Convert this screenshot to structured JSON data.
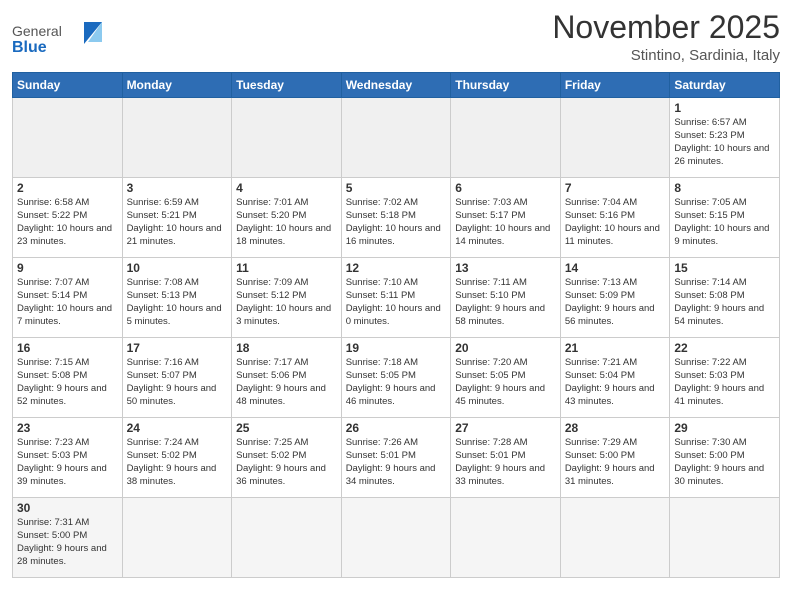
{
  "header": {
    "logo_general": "General",
    "logo_blue": "Blue",
    "month_year": "November 2025",
    "location": "Stintino, Sardinia, Italy"
  },
  "weekdays": [
    "Sunday",
    "Monday",
    "Tuesday",
    "Wednesday",
    "Thursday",
    "Friday",
    "Saturday"
  ],
  "weeks": [
    [
      {
        "day": "",
        "info": "",
        "empty": true
      },
      {
        "day": "",
        "info": "",
        "empty": true
      },
      {
        "day": "",
        "info": "",
        "empty": true
      },
      {
        "day": "",
        "info": "",
        "empty": true
      },
      {
        "day": "",
        "info": "",
        "empty": true
      },
      {
        "day": "",
        "info": "",
        "empty": true
      },
      {
        "day": "1",
        "info": "Sunrise: 6:57 AM\nSunset: 5:23 PM\nDaylight: 10 hours and 26 minutes."
      }
    ],
    [
      {
        "day": "2",
        "info": "Sunrise: 6:58 AM\nSunset: 5:22 PM\nDaylight: 10 hours and 23 minutes."
      },
      {
        "day": "3",
        "info": "Sunrise: 6:59 AM\nSunset: 5:21 PM\nDaylight: 10 hours and 21 minutes."
      },
      {
        "day": "4",
        "info": "Sunrise: 7:01 AM\nSunset: 5:20 PM\nDaylight: 10 hours and 18 minutes."
      },
      {
        "day": "5",
        "info": "Sunrise: 7:02 AM\nSunset: 5:18 PM\nDaylight: 10 hours and 16 minutes."
      },
      {
        "day": "6",
        "info": "Sunrise: 7:03 AM\nSunset: 5:17 PM\nDaylight: 10 hours and 14 minutes."
      },
      {
        "day": "7",
        "info": "Sunrise: 7:04 AM\nSunset: 5:16 PM\nDaylight: 10 hours and 11 minutes."
      },
      {
        "day": "8",
        "info": "Sunrise: 7:05 AM\nSunset: 5:15 PM\nDaylight: 10 hours and 9 minutes."
      }
    ],
    [
      {
        "day": "9",
        "info": "Sunrise: 7:07 AM\nSunset: 5:14 PM\nDaylight: 10 hours and 7 minutes."
      },
      {
        "day": "10",
        "info": "Sunrise: 7:08 AM\nSunset: 5:13 PM\nDaylight: 10 hours and 5 minutes."
      },
      {
        "day": "11",
        "info": "Sunrise: 7:09 AM\nSunset: 5:12 PM\nDaylight: 10 hours and 3 minutes."
      },
      {
        "day": "12",
        "info": "Sunrise: 7:10 AM\nSunset: 5:11 PM\nDaylight: 10 hours and 0 minutes."
      },
      {
        "day": "13",
        "info": "Sunrise: 7:11 AM\nSunset: 5:10 PM\nDaylight: 9 hours and 58 minutes."
      },
      {
        "day": "14",
        "info": "Sunrise: 7:13 AM\nSunset: 5:09 PM\nDaylight: 9 hours and 56 minutes."
      },
      {
        "day": "15",
        "info": "Sunrise: 7:14 AM\nSunset: 5:08 PM\nDaylight: 9 hours and 54 minutes."
      }
    ],
    [
      {
        "day": "16",
        "info": "Sunrise: 7:15 AM\nSunset: 5:08 PM\nDaylight: 9 hours and 52 minutes."
      },
      {
        "day": "17",
        "info": "Sunrise: 7:16 AM\nSunset: 5:07 PM\nDaylight: 9 hours and 50 minutes."
      },
      {
        "day": "18",
        "info": "Sunrise: 7:17 AM\nSunset: 5:06 PM\nDaylight: 9 hours and 48 minutes."
      },
      {
        "day": "19",
        "info": "Sunrise: 7:18 AM\nSunset: 5:05 PM\nDaylight: 9 hours and 46 minutes."
      },
      {
        "day": "20",
        "info": "Sunrise: 7:20 AM\nSunset: 5:05 PM\nDaylight: 9 hours and 45 minutes."
      },
      {
        "day": "21",
        "info": "Sunrise: 7:21 AM\nSunset: 5:04 PM\nDaylight: 9 hours and 43 minutes."
      },
      {
        "day": "22",
        "info": "Sunrise: 7:22 AM\nSunset: 5:03 PM\nDaylight: 9 hours and 41 minutes."
      }
    ],
    [
      {
        "day": "23",
        "info": "Sunrise: 7:23 AM\nSunset: 5:03 PM\nDaylight: 9 hours and 39 minutes."
      },
      {
        "day": "24",
        "info": "Sunrise: 7:24 AM\nSunset: 5:02 PM\nDaylight: 9 hours and 38 minutes."
      },
      {
        "day": "25",
        "info": "Sunrise: 7:25 AM\nSunset: 5:02 PM\nDaylight: 9 hours and 36 minutes."
      },
      {
        "day": "26",
        "info": "Sunrise: 7:26 AM\nSunset: 5:01 PM\nDaylight: 9 hours and 34 minutes."
      },
      {
        "day": "27",
        "info": "Sunrise: 7:28 AM\nSunset: 5:01 PM\nDaylight: 9 hours and 33 minutes."
      },
      {
        "day": "28",
        "info": "Sunrise: 7:29 AM\nSunset: 5:00 PM\nDaylight: 9 hours and 31 minutes."
      },
      {
        "day": "29",
        "info": "Sunrise: 7:30 AM\nSunset: 5:00 PM\nDaylight: 9 hours and 30 minutes."
      }
    ],
    [
      {
        "day": "30",
        "info": "Sunrise: 7:31 AM\nSunset: 5:00 PM\nDaylight: 9 hours and 28 minutes.",
        "lastrow": true
      },
      {
        "day": "",
        "info": "",
        "empty": true,
        "lastrow": true
      },
      {
        "day": "",
        "info": "",
        "empty": true,
        "lastrow": true
      },
      {
        "day": "",
        "info": "",
        "empty": true,
        "lastrow": true
      },
      {
        "day": "",
        "info": "",
        "empty": true,
        "lastrow": true
      },
      {
        "day": "",
        "info": "",
        "empty": true,
        "lastrow": true
      },
      {
        "day": "",
        "info": "",
        "empty": true,
        "lastrow": true
      }
    ]
  ]
}
